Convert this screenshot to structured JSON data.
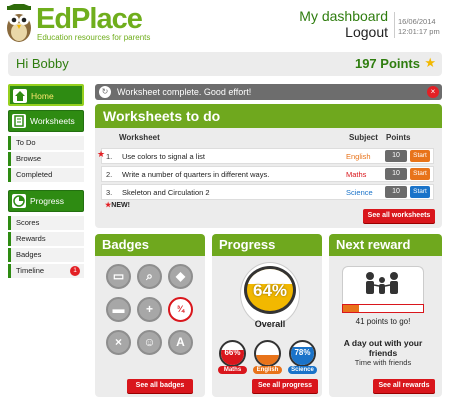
{
  "header": {
    "logo_text": "EdPlace",
    "tagline": "Education resources for parents",
    "dashboard_link": "My dashboard",
    "logout_link": "Logout",
    "date": "16/06/2014",
    "time": "12:01:17 pm"
  },
  "greeting": {
    "text": "Hi Bobby",
    "points": "197 Points",
    "points_icon": "star-icon"
  },
  "sidebar": {
    "home": "Home",
    "worksheets": "Worksheets",
    "worksheet_items": [
      "To Do",
      "Browse",
      "Completed"
    ],
    "progress": "Progress",
    "progress_items": [
      "Scores",
      "Rewards",
      "Badges",
      "Timeline"
    ],
    "timeline_count": "1"
  },
  "alert": {
    "text": "Worksheet complete. Good effort!",
    "close": "×"
  },
  "worksheets": {
    "title": "Worksheets to do",
    "headers": {
      "worksheet": "Worksheet",
      "subject": "Subject",
      "points": "Points"
    },
    "rows": [
      {
        "num": "1.",
        "name": "Use colors to signal a list",
        "subject": "English",
        "subject_color": "#e8731a",
        "points": "10",
        "start": "Start",
        "start_color": "#e8731a"
      },
      {
        "num": "2.",
        "name": "Write a number of quarters in different ways.",
        "subject": "Maths",
        "subject_color": "#d9161c",
        "points": "10",
        "start": "Start",
        "start_color": "#e8731a"
      },
      {
        "num": "3.",
        "name": "Skeleton and Circulation 2",
        "subject": "Science",
        "subject_color": "#1a73c9",
        "points": "10",
        "start": "Start",
        "start_color": "#1a73c9"
      }
    ],
    "new_label": "NEW!",
    "see_all": "See all worksheets"
  },
  "badges": {
    "title": "Badges",
    "see_all": "See all badges",
    "items": [
      {
        "name": "basket-icon",
        "glyph": "▭"
      },
      {
        "name": "magnifier-icon",
        "glyph": "⌕"
      },
      {
        "name": "drop-icon",
        "glyph": "◆"
      },
      {
        "name": "bus-icon",
        "glyph": "▬"
      },
      {
        "name": "plus-icon",
        "glyph": "+"
      },
      {
        "name": "fraction-icon",
        "glyph": "¾"
      },
      {
        "name": "times-icon",
        "glyph": "×"
      },
      {
        "name": "people-icon",
        "glyph": "☺"
      },
      {
        "name": "letter-a-icon",
        "glyph": "A"
      }
    ]
  },
  "progress": {
    "title": "Progress",
    "overall_pct": "64%",
    "overall_value": 0.64,
    "overall_label": "Overall",
    "subjects": [
      {
        "name": "Maths",
        "pct": "66%",
        "value": 0.66,
        "color": "#d9161c"
      },
      {
        "name": "English",
        "pct": "44%",
        "value": 0.44,
        "color": "#e8731a"
      },
      {
        "name": "Science",
        "pct": "78%",
        "value": 0.78,
        "color": "#1a73c9"
      }
    ],
    "see_all": "See all progress"
  },
  "reward": {
    "title": "Next reward",
    "to_go": "41 points to go!",
    "progress_value": 0.2,
    "description": "A day out with your friends",
    "subtitle": "Time with friends",
    "see_all": "See all rewards"
  }
}
